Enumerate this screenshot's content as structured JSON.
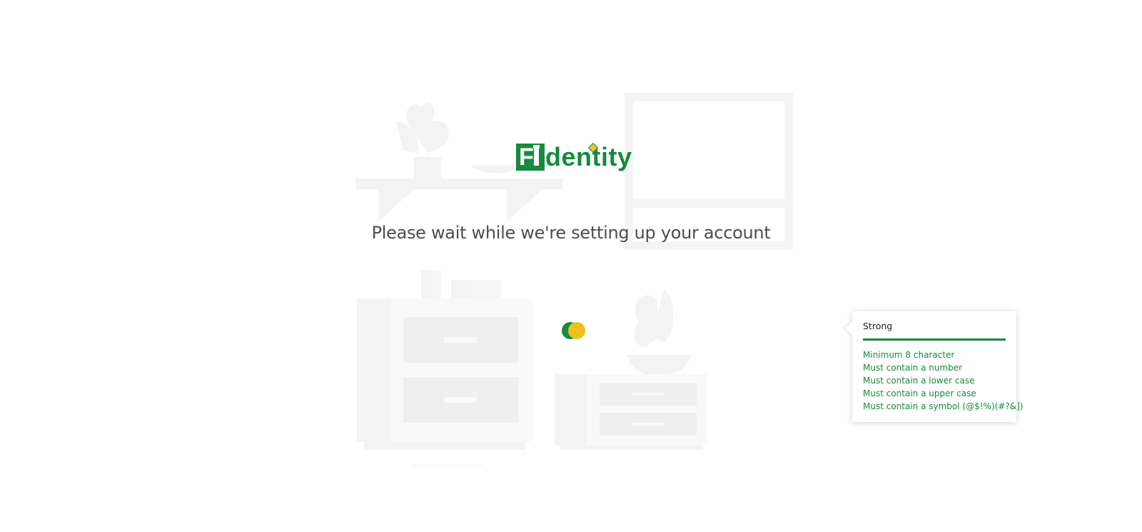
{
  "logo": {
    "box_letter": "F",
    "text": "dentity",
    "brand_color": "#168a3e",
    "accent_color": "#f2c230"
  },
  "status": {
    "message": "Please wait while we're setting up your account"
  },
  "loader": {
    "colors": [
      "#168a3e",
      "#f0bf1e"
    ]
  },
  "password_tooltip": {
    "strength_label": "Strong",
    "rules": [
      "Minimum 8 character",
      "Must contain a number",
      "Must contain a lower case",
      "Must contain a upper case",
      "Must contain a symbol (@$!%)(#?&])"
    ]
  }
}
